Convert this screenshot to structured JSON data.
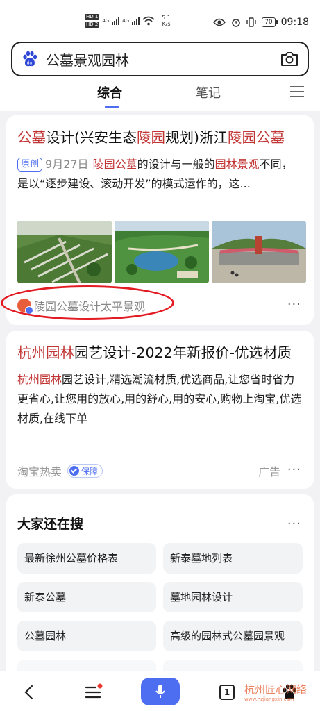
{
  "status_bar": {
    "hd1": "HD 1",
    "hd2": "HD 2",
    "net1": "4G",
    "net2": "4G",
    "speed_value": "5.1",
    "speed_unit": "K/s",
    "battery": "70",
    "time": "09:18"
  },
  "search": {
    "query": "公墓景观园林",
    "logo_icon": "baidu-paw-icon",
    "camera_icon": "camera-icon"
  },
  "tabs": [
    {
      "label": "综合",
      "active": true
    },
    {
      "label": "笔记",
      "active": false
    }
  ],
  "results": [
    {
      "title_parts": [
        {
          "text": "公墓",
          "hl": true
        },
        {
          "text": "设计(兴安生态",
          "hl": false
        },
        {
          "text": "陵园",
          "hl": true
        },
        {
          "text": "规划)浙江",
          "hl": false
        },
        {
          "text": "陵园公墓",
          "hl": true
        }
      ],
      "badge": "原创",
      "date": "9月27日",
      "snippet_parts": [
        {
          "text": "陵园公墓",
          "hl": true
        },
        {
          "text": "的设计与一般的",
          "hl": false
        },
        {
          "text": "园林景观",
          "hl": true
        },
        {
          "text": "不同，是以“逐步建设、滚动开发”的模式运作的，这...",
          "hl": false
        }
      ],
      "source": "陵园公墓设计太平景观",
      "more": "···"
    },
    {
      "title_parts": [
        {
          "text": "杭州园林",
          "hl": true
        },
        {
          "text": "园艺设计-2022年新报价-优选材质",
          "hl": false
        }
      ],
      "snippet_parts": [
        {
          "text": "杭州园林",
          "hl": true
        },
        {
          "text": "园艺设计,精选潮流材质,优选商品,让您省时省力更省心,让您用的放心,用的舒心,用的安心,购物上淘宝,优选材质,在线下单",
          "hl": false
        }
      ],
      "source": "淘宝热卖",
      "guarantee": "保障",
      "ad": "广告",
      "more": "···"
    }
  ],
  "related": {
    "title": "大家还在搜",
    "more": "···",
    "items": [
      "最新徐州公墓价格表",
      "新泰墓地列表",
      "新泰公墓",
      "墓地园林设计",
      "公墓园林",
      "高级的园林式公墓园景观"
    ]
  },
  "bottom_nav": {
    "page_count": "1",
    "watermark": "杭州匠心网络",
    "watermark_url": "www.hzjiangxin.com"
  },
  "colors": {
    "accent": "#4e6ef2",
    "highlight": "#c23535",
    "annotation": "#e31b23"
  }
}
